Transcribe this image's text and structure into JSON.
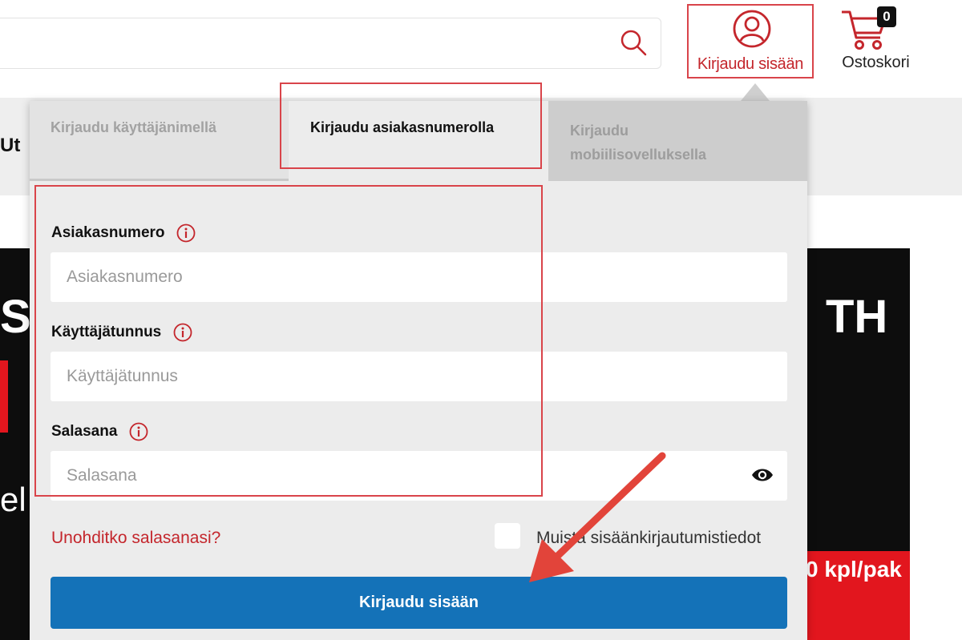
{
  "header": {
    "search": {
      "value": "",
      "placeholder": "",
      "icon": "search-icon"
    },
    "login": {
      "label": "Kirjaudu sisään",
      "icon": "user-icon"
    },
    "cart": {
      "label": "Ostoskori",
      "count": "0",
      "icon": "cart-icon"
    }
  },
  "background": {
    "nav_partial_text": "Ut",
    "banner": {
      "text_left": "S",
      "text_right": "TH",
      "text_el": "el",
      "promo_text": "0 kpl/pak"
    }
  },
  "login_panel": {
    "tabs": [
      {
        "label": "Kirjaudu käyttäjänimellä",
        "active": false
      },
      {
        "label": "Kirjaudu asiakasnumerolla",
        "active": true
      },
      {
        "label_line1": "Kirjaudu",
        "label_line2": "mobiilisovelluksella",
        "active": false
      }
    ],
    "fields": {
      "customer_number": {
        "label": "Asiakasnumero",
        "placeholder": "Asiakasnumero",
        "value": ""
      },
      "username": {
        "label": "Käyttäjätunnus",
        "placeholder": "Käyttäjätunnus",
        "value": ""
      },
      "password": {
        "label": "Salasana",
        "placeholder": "Salasana",
        "value": ""
      }
    },
    "forgot_password": "Unohditko salasanasi?",
    "remember_me": "Muista sisäänkirjautumistiedot",
    "submit": "Kirjaudu sisään"
  },
  "colors": {
    "accent_red": "#c4262c",
    "annotation_red": "#d9444a",
    "primary_blue": "#1472b8",
    "panel_bg": "#ececec"
  }
}
